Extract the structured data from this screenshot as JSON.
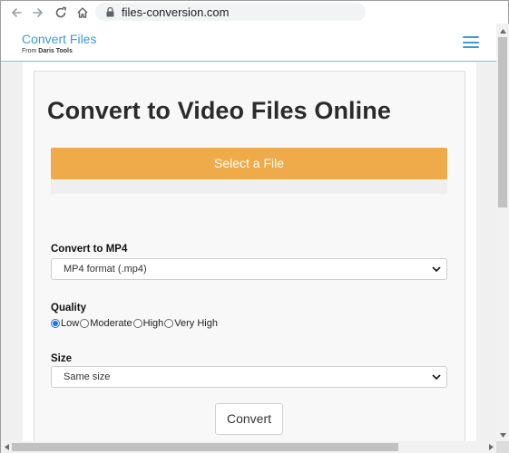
{
  "browser": {
    "url": "files-conversion.com"
  },
  "site": {
    "title": "Convert Files",
    "sub_prefix": "From ",
    "sub_brand": "Daris Tools"
  },
  "main": {
    "page_title": "Convert to Video Files Online",
    "select_file_label": "Select a File",
    "convert_to_label": "Convert to MP4",
    "format_selected": "MP4 format (.mp4)",
    "quality_label": "Quality",
    "quality_options": [
      {
        "label": "Low",
        "checked": true
      },
      {
        "label": "Moderate",
        "checked": false
      },
      {
        "label": "High",
        "checked": false
      },
      {
        "label": "Very High",
        "checked": false
      }
    ],
    "size_label": "Size",
    "size_selected": "Same size",
    "convert_button": "Convert"
  },
  "colors": {
    "accent": "#3a9bd5",
    "select_button": "#efab4a"
  },
  "icons": [
    "back-arrow-icon",
    "forward-arrow-icon",
    "reload-icon",
    "home-icon",
    "lock-icon",
    "hamburger-menu-icon",
    "chevron-down-icon"
  ]
}
